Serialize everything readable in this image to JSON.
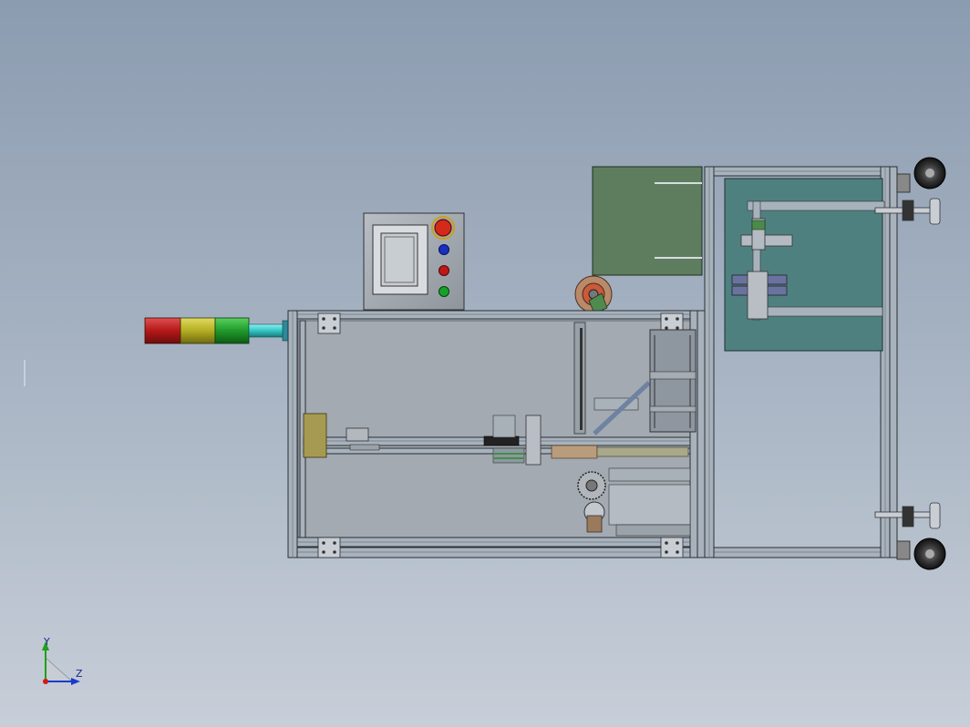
{
  "viewport": {
    "background_top": "#8c9cb0",
    "background_bottom": "#c7ced8"
  },
  "model": {
    "frame_color": "#a8b2bc",
    "panel_color": "#a3aab1",
    "green_panel_color": "#5e7d5e",
    "teal_panel_color": "#4f8080",
    "control_box": {
      "buttons": [
        {
          "name": "emergency-stop",
          "color": "#d42a1a"
        },
        {
          "name": "blue-button",
          "color": "#1a2fbf"
        },
        {
          "name": "red-button",
          "color": "#c01818"
        },
        {
          "name": "green-button",
          "color": "#16a02a"
        }
      ]
    },
    "signal_tower": {
      "lights": [
        {
          "name": "red-light",
          "color": "#b41818"
        },
        {
          "name": "yellow-light",
          "color": "#b4ae22"
        },
        {
          "name": "green-light",
          "color": "#1f9a2a"
        }
      ],
      "pole_color": "#35c4c4"
    }
  },
  "triad": {
    "y_label": "Y",
    "z_label": "Z",
    "y_color": "#1ea01e",
    "z_color": "#1a3acc",
    "x_color": "#d01818"
  }
}
